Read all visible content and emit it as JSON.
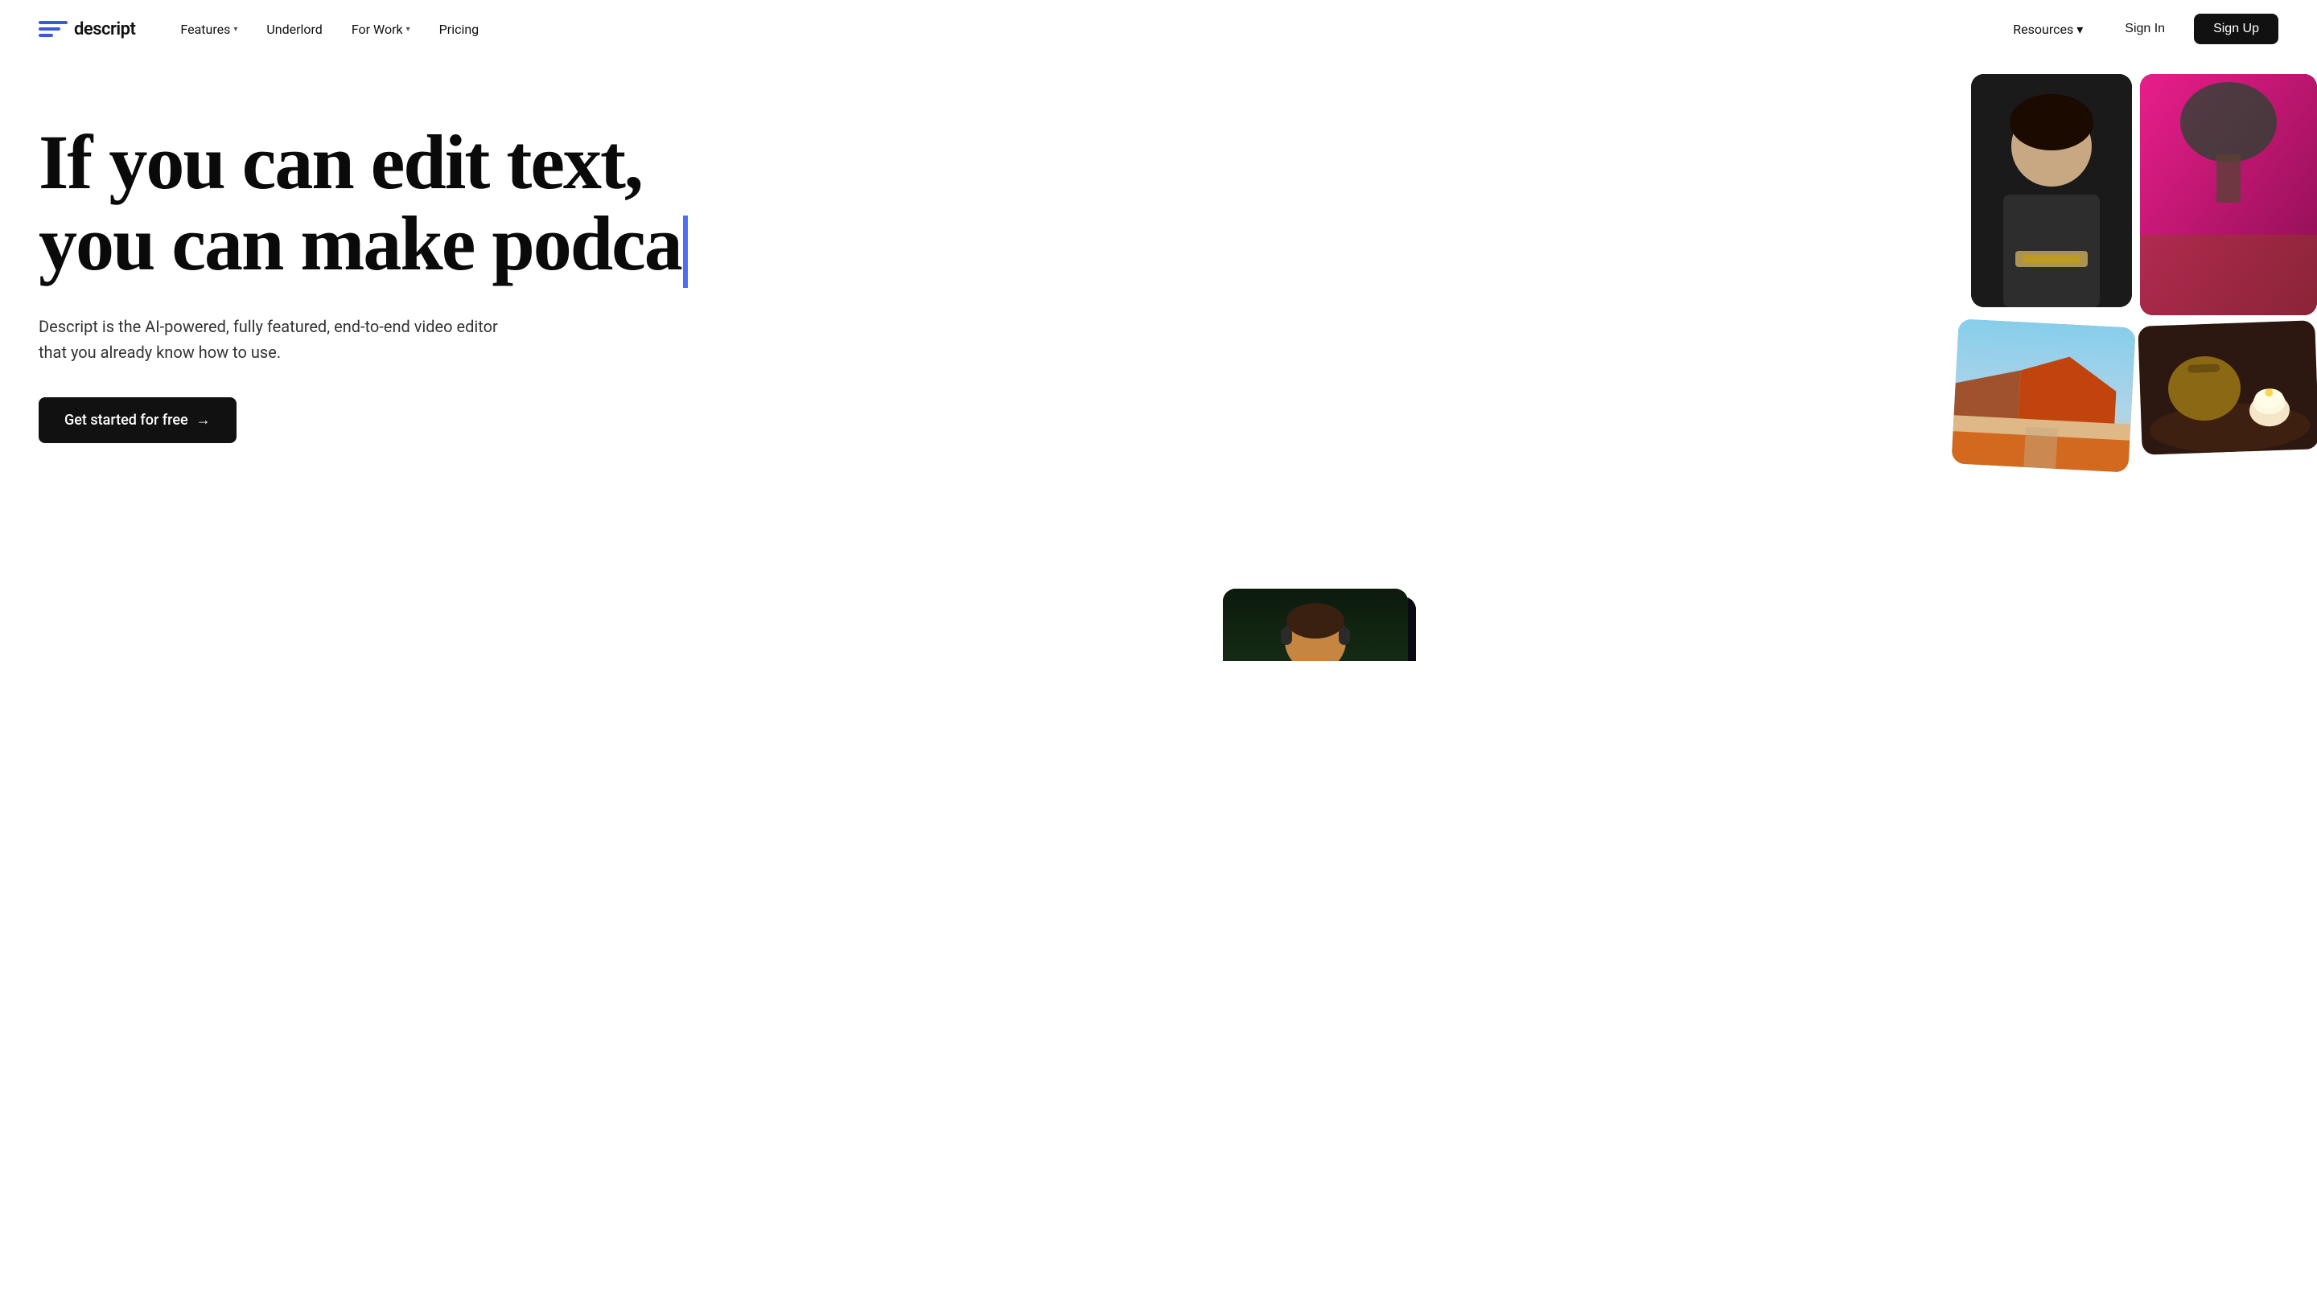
{
  "logo": {
    "text": "descript"
  },
  "nav": {
    "links": [
      {
        "label": "Features",
        "hasDropdown": true
      },
      {
        "label": "Underlord",
        "hasDropdown": false
      },
      {
        "label": "For Work",
        "hasDropdown": true
      },
      {
        "label": "Pricing",
        "hasDropdown": false
      }
    ],
    "right": {
      "resources_label": "Resources",
      "sign_in_label": "Sign In",
      "sign_up_label": "Sign Up"
    }
  },
  "hero": {
    "headline_line1": "If you can edit text,",
    "headline_line2": "you can make podca",
    "subtitle": "Descript is the AI-powered, fully featured, end-to-end video editor that you already know how to use.",
    "cta_label": "Get started for free",
    "cta_arrow": "→"
  },
  "colors": {
    "cursor": "#4c6ef5",
    "cta_bg": "#111111",
    "sign_up_bg": "#111111",
    "logo_blue": "#3b5bdb"
  }
}
